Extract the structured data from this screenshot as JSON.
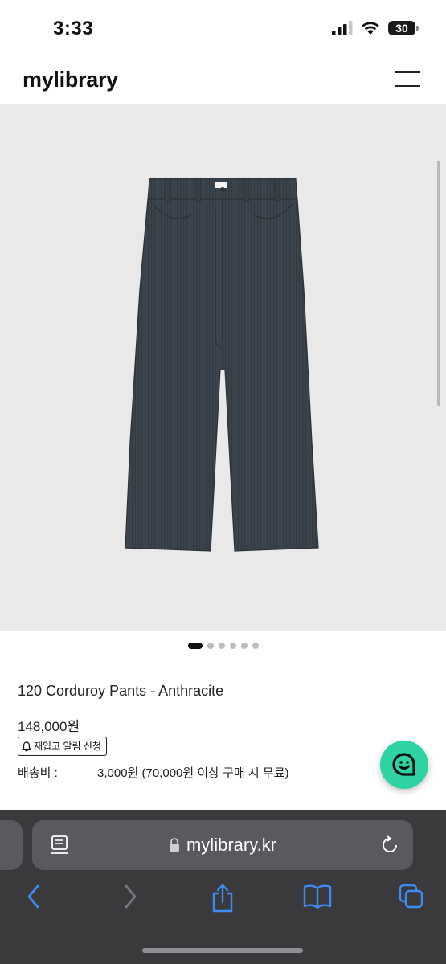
{
  "status_bar": {
    "time": "3:33",
    "battery": "30"
  },
  "header": {
    "logo": "mylibrary"
  },
  "product": {
    "name": "120 Corduroy Pants - Anthracite",
    "price": "148,000원",
    "restock_label": "재입고 알림 신청",
    "shipping_label": "배송비 :",
    "shipping_value": "3,000원 (70,000원 이상 구매 시 무료)",
    "image_dots": {
      "count": 6,
      "active_index": 0
    },
    "color": "#3a434b"
  },
  "browser": {
    "url": "mylibrary.kr"
  },
  "colors": {
    "accent_chat": "#2ed3a4",
    "browser_accent": "#3e8bf4"
  }
}
